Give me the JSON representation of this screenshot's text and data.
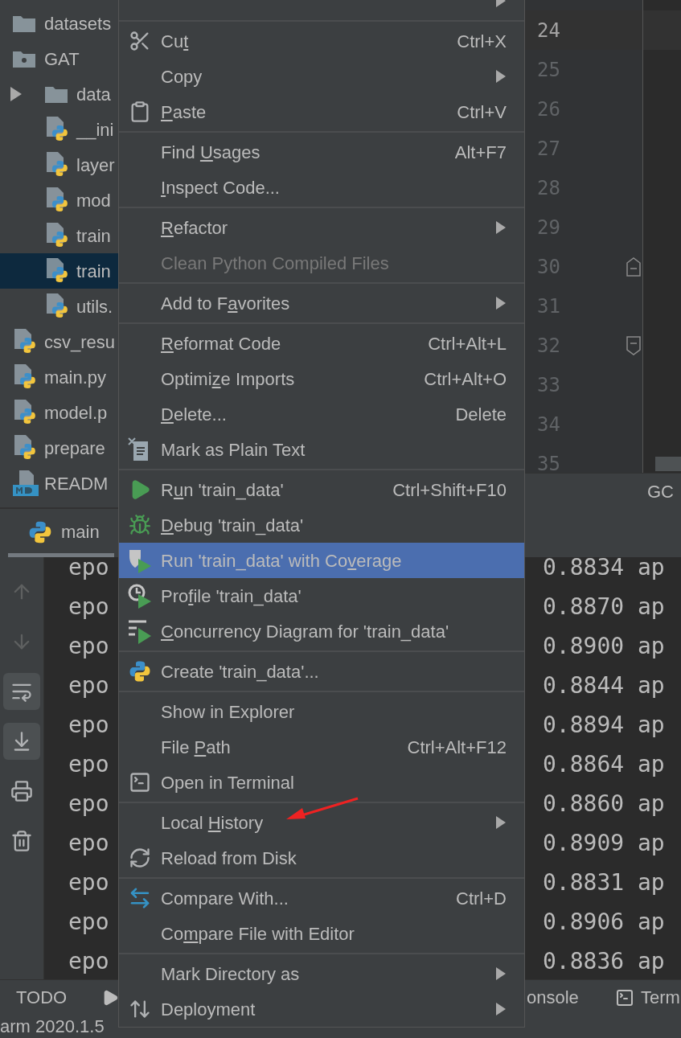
{
  "project_tree": [
    {
      "name": "datasets",
      "kind": "folder",
      "selected": false
    },
    {
      "name": "GAT",
      "kind": "module",
      "selected": false,
      "children": [
        {
          "name": "data",
          "kind": "folder",
          "expanded": false,
          "selected": false
        },
        {
          "name": "__ini",
          "kind": "python",
          "selected": false
        },
        {
          "name": "layer",
          "kind": "python",
          "selected": false
        },
        {
          "name": "mod",
          "kind": "python",
          "selected": false
        },
        {
          "name": "train",
          "kind": "python",
          "selected": false
        },
        {
          "name": "train",
          "kind": "python",
          "selected": true
        },
        {
          "name": "utils.",
          "kind": "python",
          "selected": false
        }
      ]
    },
    {
      "name": "csv_resu",
      "kind": "python",
      "selected": false
    },
    {
      "name": "main.py",
      "kind": "python",
      "selected": false
    },
    {
      "name": "model.p",
      "kind": "python",
      "selected": false
    },
    {
      "name": "prepare",
      "kind": "python",
      "selected": false
    },
    {
      "name": "READM",
      "kind": "markdown",
      "selected": false
    }
  ],
  "editor": {
    "lines": [
      {
        "number": "24",
        "current": true,
        "kind": "line"
      },
      {
        "number": "25",
        "current": false,
        "kind": "line"
      },
      {
        "number": "26",
        "current": false,
        "kind": "line"
      },
      {
        "number": "27",
        "current": false,
        "kind": "line"
      },
      {
        "number": "28",
        "current": false,
        "kind": "line"
      },
      {
        "number": "29",
        "current": false,
        "kind": "line"
      },
      {
        "number": "30",
        "current": false,
        "kind": "fold_start"
      },
      {
        "number": "31",
        "current": false,
        "kind": "line"
      },
      {
        "number": "32",
        "current": false,
        "kind": "fold_end"
      },
      {
        "number": "33",
        "current": false,
        "kind": "line"
      },
      {
        "number": "34",
        "current": false,
        "kind": "line"
      },
      {
        "number": "35",
        "current": false,
        "kind": "line"
      }
    ],
    "tab": "GC"
  },
  "run_window": {
    "tab": {
      "label": "main",
      "selected": true
    },
    "toolbar": [
      {
        "disabled": true,
        "on": false
      },
      {
        "disabled": true,
        "on": false
      },
      {
        "disabled": false,
        "on": true
      },
      {
        "disabled": false,
        "on": true
      },
      {
        "disabled": false,
        "on": false
      },
      {
        "disabled": false,
        "on": false
      }
    ],
    "console": [
      {
        "left": "epo",
        "right": "0.8834 ap"
      },
      {
        "left": "epo",
        "right": "0.8870 ap"
      },
      {
        "left": "epo",
        "right": "0.8900 ap"
      },
      {
        "left": "epo",
        "right": "0.8844 ap"
      },
      {
        "left": "epo",
        "right": "0.8894 ap"
      },
      {
        "left": "epo",
        "right": "0.8864 ap"
      },
      {
        "left": "epo",
        "right": "0.8860 ap"
      },
      {
        "left": "epo",
        "right": "0.8909 ap"
      },
      {
        "left": "epo",
        "right": "0.8831 ap"
      },
      {
        "left": "epo",
        "right": "0.8906 ap"
      },
      {
        "left": "epo",
        "right": "0.8836 ap"
      }
    ]
  },
  "bottom_tabs": [
    {
      "label": "TODO"
    },
    {
      "label": "onsole"
    },
    {
      "label": "Term"
    }
  ],
  "status_bar": "arm 2020.1.5",
  "context_menu": {
    "groups": [
      [
        {
          "submenu": true,
          "selected": false
        }
      ],
      [
        {
          "label": [
            {
              "text": "Cu",
              "underline": false
            },
            {
              "text": "t",
              "underline": true
            }
          ],
          "shortcut": "Ctrl+X",
          "submenu": false,
          "disabled": false,
          "selected": false
        },
        {
          "label": [
            {
              "text": "Copy",
              "underline": false
            }
          ],
          "submenu": true,
          "disabled": false,
          "selected": false
        },
        {
          "label": [
            {
              "text": "P",
              "underline": true
            },
            {
              "text": "aste",
              "underline": false
            }
          ],
          "shortcut": "Ctrl+V",
          "submenu": false,
          "disabled": false,
          "selected": false
        }
      ],
      [
        {
          "label": [
            {
              "text": "Find ",
              "underline": false
            },
            {
              "text": "U",
              "underline": true
            },
            {
              "text": "sages",
              "underline": false
            }
          ],
          "shortcut": "Alt+F7",
          "submenu": false,
          "disabled": false,
          "selected": false
        },
        {
          "label": [
            {
              "text": "I",
              "underline": true
            },
            {
              "text": "nspect Code...",
              "underline": false
            }
          ],
          "submenu": false,
          "disabled": false,
          "selected": false
        }
      ],
      [
        {
          "label": [
            {
              "text": "R",
              "underline": true
            },
            {
              "text": "efactor",
              "underline": false
            }
          ],
          "submenu": true,
          "disabled": false,
          "selected": false
        },
        {
          "label": [
            {
              "text": "Clean Python Compiled Files",
              "underline": false
            }
          ],
          "submenu": false,
          "disabled": true,
          "selected": false
        }
      ],
      [
        {
          "label": [
            {
              "text": "Add to F",
              "underline": false
            },
            {
              "text": "a",
              "underline": true
            },
            {
              "text": "vorites",
              "underline": false
            }
          ],
          "submenu": true,
          "disabled": false,
          "selected": false
        }
      ],
      [
        {
          "label": [
            {
              "text": "R",
              "underline": true
            },
            {
              "text": "eformat Code",
              "underline": false
            }
          ],
          "shortcut": "Ctrl+Alt+L",
          "submenu": false,
          "disabled": false,
          "selected": false
        },
        {
          "label": [
            {
              "text": "Optimi",
              "underline": false
            },
            {
              "text": "z",
              "underline": true
            },
            {
              "text": "e Imports",
              "underline": false
            }
          ],
          "shortcut": "Ctrl+Alt+O",
          "submenu": false,
          "disabled": false,
          "selected": false
        },
        {
          "label": [
            {
              "text": "D",
              "underline": true
            },
            {
              "text": "elete...",
              "underline": false
            }
          ],
          "shortcut": "Delete",
          "submenu": false,
          "disabled": false,
          "selected": false
        },
        {
          "label": [
            {
              "text": "Mark as Plain Text",
              "underline": false
            }
          ],
          "submenu": false,
          "disabled": false,
          "selected": false
        }
      ],
      [
        {
          "label": [
            {
              "text": "R",
              "underline": false
            },
            {
              "text": "u",
              "underline": true
            },
            {
              "text": "n 'train_data'",
              "underline": false
            }
          ],
          "shortcut": "Ctrl+Shift+F10",
          "submenu": false,
          "disabled": false,
          "selected": false
        },
        {
          "label": [
            {
              "text": "D",
              "underline": true
            },
            {
              "text": "ebug 'train_data'",
              "underline": false
            }
          ],
          "submenu": false,
          "disabled": false,
          "selected": false
        },
        {
          "label": [
            {
              "text": "Run 'train_data' with Co",
              "underline": false
            },
            {
              "text": "v",
              "underline": true
            },
            {
              "text": "erage",
              "underline": false
            }
          ],
          "submenu": false,
          "disabled": false,
          "selected": true
        },
        {
          "label": [
            {
              "text": "Pro",
              "underline": false
            },
            {
              "text": "f",
              "underline": true
            },
            {
              "text": "ile 'train_data'",
              "underline": false
            }
          ],
          "submenu": false,
          "disabled": false,
          "selected": false
        },
        {
          "label": [
            {
              "text": "C",
              "underline": true
            },
            {
              "text": "oncurrency Diagram for 'train_data'",
              "underline": false
            }
          ],
          "submenu": false,
          "disabled": false,
          "selected": false
        }
      ],
      [
        {
          "label": [
            {
              "text": "Create 'train_data'...",
              "underline": false
            }
          ],
          "submenu": false,
          "disabled": false,
          "selected": false
        }
      ],
      [
        {
          "label": [
            {
              "text": "Show in Explorer",
              "underline": false
            }
          ],
          "submenu": false,
          "disabled": false,
          "selected": false
        },
        {
          "label": [
            {
              "text": "File ",
              "underline": false
            },
            {
              "text": "P",
              "underline": true
            },
            {
              "text": "ath",
              "underline": false
            }
          ],
          "shortcut": "Ctrl+Alt+F12",
          "submenu": false,
          "disabled": false,
          "selected": false
        },
        {
          "label": [
            {
              "text": "Open in Terminal",
              "underline": false
            }
          ],
          "submenu": false,
          "disabled": false,
          "selected": false
        }
      ],
      [
        {
          "label": [
            {
              "text": "Local ",
              "underline": false
            },
            {
              "text": "H",
              "underline": true
            },
            {
              "text": "istory",
              "underline": false
            }
          ],
          "submenu": true,
          "disabled": false,
          "selected": false
        },
        {
          "label": [
            {
              "text": "Reload from Disk",
              "underline": false
            }
          ],
          "submenu": false,
          "disabled": false,
          "selected": false
        }
      ],
      [
        {
          "label": [
            {
              "text": "Compare With...",
              "underline": false
            }
          ],
          "shortcut": "Ctrl+D",
          "submenu": false,
          "disabled": false,
          "selected": false
        },
        {
          "label": [
            {
              "text": "Co",
              "underline": false
            },
            {
              "text": "m",
              "underline": true
            },
            {
              "text": "pare File with Editor",
              "underline": false
            }
          ],
          "submenu": false,
          "disabled": false,
          "selected": false
        }
      ],
      [
        {
          "label": [
            {
              "text": "Mark Directory as",
              "underline": false
            }
          ],
          "submenu": true,
          "disabled": false,
          "selected": false
        },
        {
          "label": [
            {
              "text": "Deployment",
              "underline": false
            }
          ],
          "submenu": true,
          "disabled": false,
          "selected": false
        }
      ]
    ]
  }
}
